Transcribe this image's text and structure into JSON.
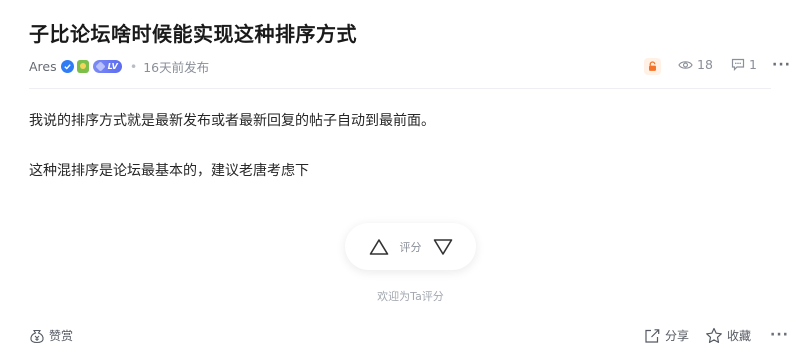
{
  "post": {
    "title": "子比论坛啥时候能实现这种排序方式",
    "author": "Ares",
    "level_badge": "LV",
    "time_sep": "•",
    "posted": "16天前发布",
    "views": "18",
    "comments": "1",
    "more": "···",
    "body": [
      "我说的排序方式就是最新发布或者最新回复的帖子自动到最前面。",
      "这种混排序是论坛最基本的，建议老唐考虑下"
    ]
  },
  "rating": {
    "label": "评分",
    "invite": "欢迎为Ta评分"
  },
  "footer": {
    "reward": "赞赏",
    "share": "分享",
    "favorite": "收藏",
    "more": "···"
  },
  "colors": {
    "accent_orange": "#f5742a",
    "verified_blue": "#2f7cf6",
    "lv_badge": "#6b79f2"
  },
  "icons": [
    "verified-icon",
    "medal-icon",
    "level-badge-icon",
    "lock-icon",
    "eye-icon",
    "comment-icon",
    "more-icon",
    "upvote-icon",
    "downvote-icon",
    "reward-icon",
    "share-icon",
    "star-icon"
  ]
}
